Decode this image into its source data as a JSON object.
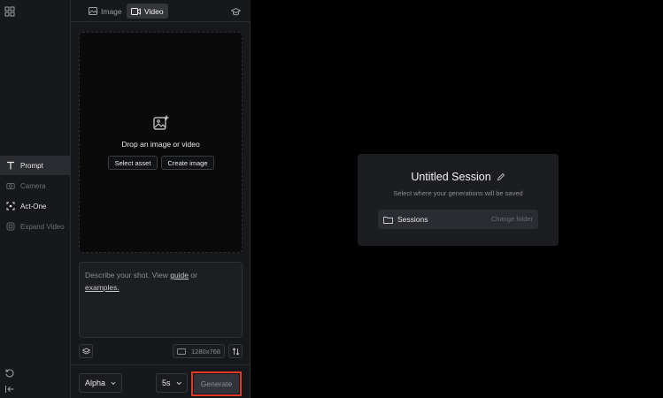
{
  "topbar": {
    "tabs": [
      {
        "label": "Image",
        "icon": "image-icon",
        "active": false
      },
      {
        "label": "Video",
        "icon": "video-icon",
        "active": true
      }
    ]
  },
  "rail": {
    "items": [
      {
        "label": "Prompt",
        "icon": "text-t-icon",
        "active": true
      },
      {
        "label": "Camera",
        "icon": "camera-icon",
        "active": false
      },
      {
        "label": "Act-One",
        "icon": "act-one-icon",
        "active": false
      },
      {
        "label": "Expand Video",
        "icon": "expand-icon",
        "active": false
      }
    ]
  },
  "dropzone": {
    "title": "Drop an image or video",
    "select_asset": "Select asset",
    "create_image": "Create image"
  },
  "prompt": {
    "text_before": "Describe your shot. View ",
    "guide_link": "guide",
    "text_mid": " or",
    "examples_link": "examples."
  },
  "toolbar": {
    "resolution": "1280x768"
  },
  "footer": {
    "model": "Alpha",
    "duration": "5s",
    "generate": "Generate"
  },
  "session": {
    "title": "Untitled Session",
    "subtitle": "Select where your generations will be saved",
    "folder": "Sessions",
    "change_folder": "Change folder"
  },
  "colors": {
    "accent_highlight": "#e03a26",
    "panel_bg": "#17181b",
    "canvas_bg": "#000000"
  }
}
